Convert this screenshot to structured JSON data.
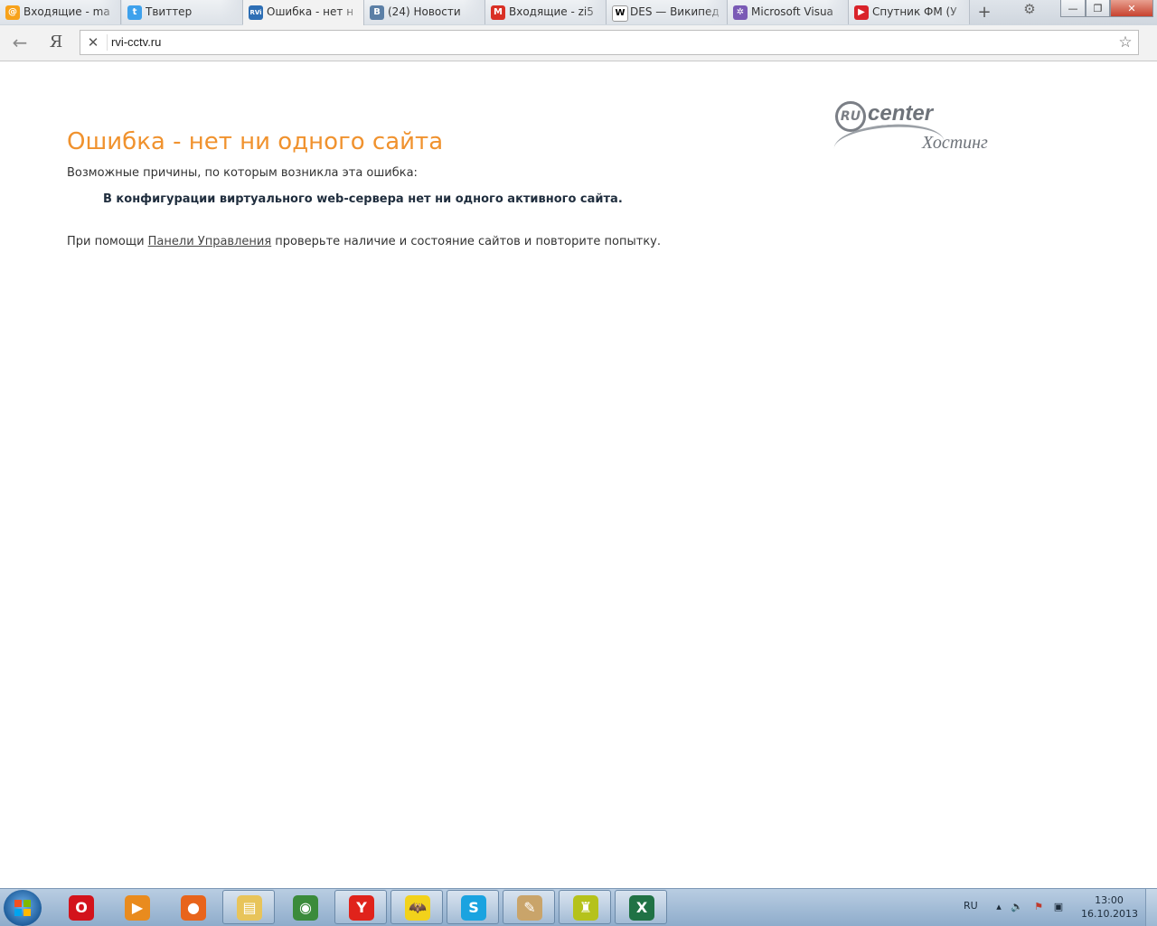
{
  "browser": {
    "tabs": [
      {
        "label": "Входящие - ma",
        "icon": "mail-ru-icon",
        "color": "#f7a21b",
        "glyph": "@"
      },
      {
        "label": "Твиттер",
        "icon": "twitter-icon",
        "color": "#3ea1ec",
        "glyph": "t"
      },
      {
        "label": "Ошибка - нет н",
        "icon": "rvi-icon",
        "color": "#2e6fb5",
        "glyph": "RVi",
        "active": true
      },
      {
        "label": "(24) Новости",
        "icon": "vk-icon",
        "color": "#5b7fa6",
        "glyph": "B"
      },
      {
        "label": "Входящие - zi5",
        "icon": "gmail-icon",
        "color": "#d93025",
        "glyph": "M"
      },
      {
        "label": "DES — Википед",
        "icon": "wikipedia-icon",
        "color": "#ffffff",
        "glyph": "W"
      },
      {
        "label": "Microsoft Visua",
        "icon": "visual-studio-icon",
        "color": "#7a5ab5",
        "glyph": "✲"
      },
      {
        "label": "Спутник ФМ (У",
        "icon": "sputnik-fm-icon",
        "color": "#d9232a",
        "glyph": "▶"
      }
    ],
    "new_tab_glyph": "+",
    "settings_glyph": "⚙",
    "minimize_glyph": "—",
    "maximize_glyph": "❐",
    "close_glyph": "✕",
    "back_glyph": "←",
    "yandex_glyph": "Я",
    "stop_glyph": "✕",
    "url": "rvi-cctv.ru",
    "star_glyph": "☆"
  },
  "page": {
    "logo": {
      "ru": "RU",
      "center": "center",
      "hosting": "Хостинг"
    },
    "title": "Ошибка - нет ни одного сайта",
    "reasons_label": "Возможные причины, по которым возникла эта ошибка:",
    "reason": "В конфигурации виртуального web-сервера нет ни одного активного сайта.",
    "help_prefix": "При помощи ",
    "help_link": "Панели Управления",
    "help_suffix": " проверьте наличие и состояние сайтов и повторите попытку."
  },
  "taskbar": {
    "items": [
      {
        "name": "opera",
        "icon": "opera-icon",
        "color": "#d3131b",
        "glyph": "O",
        "open": false
      },
      {
        "name": "media-player",
        "icon": "media-player-icon",
        "color": "#e98b1e",
        "glyph": "▶",
        "open": false
      },
      {
        "name": "firefox",
        "icon": "firefox-icon",
        "color": "#e8641b",
        "glyph": "●",
        "open": false
      },
      {
        "name": "explorer",
        "icon": "folder-icon",
        "color": "#e8c45a",
        "glyph": "▤",
        "open": true
      },
      {
        "name": "chrome",
        "icon": "chrome-icon",
        "color": "#3b8b3b",
        "glyph": "◉",
        "open": false
      },
      {
        "name": "yandex-browser",
        "icon": "yandex-browser-icon",
        "color": "#e0231b",
        "glyph": "Y",
        "open": true
      },
      {
        "name": "the-bat",
        "icon": "the-bat-icon",
        "color": "#f2d21b",
        "glyph": "🦇",
        "open": true
      },
      {
        "name": "skype",
        "icon": "skype-icon",
        "color": "#1aa3e0",
        "glyph": "S",
        "open": true
      },
      {
        "name": "paint",
        "icon": "paint-icon",
        "color": "#c9a46a",
        "glyph": "✎",
        "open": true
      },
      {
        "name": "game",
        "icon": "game-icon",
        "color": "#b5c21b",
        "glyph": "♜",
        "open": true
      },
      {
        "name": "excel",
        "icon": "excel-icon",
        "color": "#207245",
        "glyph": "X",
        "open": true
      }
    ],
    "lang": "RU",
    "time": "13:00",
    "date": "16.10.2013"
  }
}
